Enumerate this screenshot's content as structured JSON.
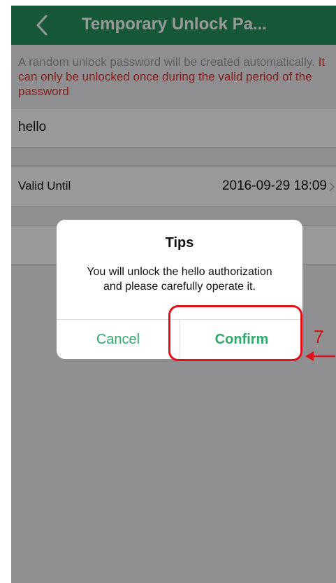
{
  "header": {
    "title": "Temporary Unlock Pa..."
  },
  "notice": {
    "gray_text": "A random unlock password will be created automatically.",
    "red_text": "It can only be unlocked once during the valid period of the password"
  },
  "form": {
    "name_value": "hello",
    "valid_until_label": "Valid Until",
    "valid_until_value": "2016-09-29 18:09"
  },
  "dialog": {
    "title": "Tips",
    "message_line1": "You will unlock the hello authorization",
    "message_line2": "and please carefully operate it.",
    "cancel_label": "Cancel",
    "confirm_label": "Confirm"
  },
  "annotation": {
    "step_number": "7"
  },
  "colors": {
    "header": "#24925a",
    "accent": "#2fa96b",
    "warning": "#e3322b",
    "annotation": "#e0101a"
  },
  "icons": {
    "back": "chevron-left-icon",
    "row_arrow": "chevron-right-icon",
    "pointer": "arrow-left-icon"
  }
}
